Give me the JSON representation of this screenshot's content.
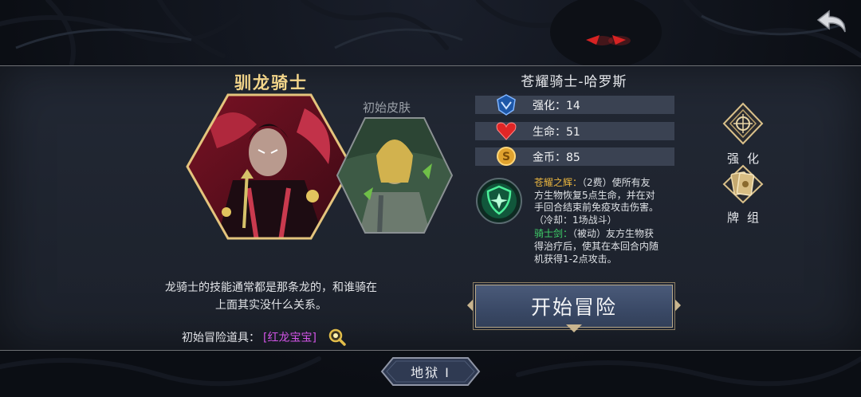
{
  "class_title": "驯龙骑士",
  "skin": {
    "label": "初始皮肤"
  },
  "description_lines": [
    "龙骑士的技能通常都是那条龙的，和谁骑在",
    "上面其实没什么关系。"
  ],
  "starting_item": {
    "label": "初始冒险道具：",
    "name": "[红龙宝宝]"
  },
  "hero": {
    "name": "苍耀骑士-哈罗斯",
    "stats": [
      {
        "icon": "enhance-icon",
        "text": "强化：14"
      },
      {
        "icon": "heart-icon",
        "text": "生命：51"
      },
      {
        "icon": "coin-icon",
        "text": "金币：85"
      }
    ],
    "skills": {
      "active_name": "苍耀之辉：",
      "active_desc_lines": [
        "（2费）使所有友",
        "方生物恢复5点生命，并在对",
        "手回合结束前免疫攻击伤害。",
        "（冷却：1场战斗）"
      ],
      "passive_name": "骑士剑：",
      "passive_desc_lines": [
        "（被动）友方生物获",
        "得治疗后，使其在本回合内随",
        "机获得1-2点攻击。"
      ]
    }
  },
  "side_buttons": {
    "enhance": "强化",
    "deck": "牌组"
  },
  "start_button": "开始冒险",
  "difficulty": "地狱 I",
  "colors": {
    "gold": "#f3d58a",
    "item_purple": "#d254e6",
    "skill_gold": "#e7b33f",
    "skill_green": "#3fd36a"
  }
}
